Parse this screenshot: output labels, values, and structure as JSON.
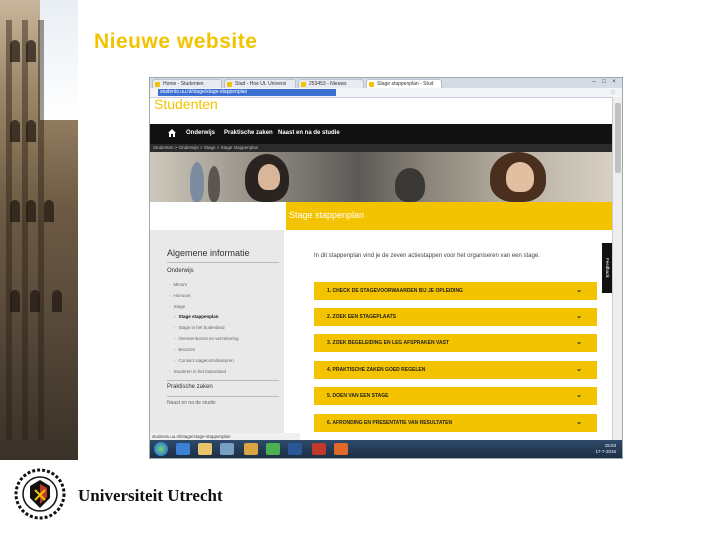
{
  "slide": {
    "title": "Nieuwe website",
    "logo_text": "Universiteit Utrecht",
    "accent_color": "#f3c300"
  },
  "browser": {
    "tabs": [
      {
        "label": "Home - Studenten",
        "active": false
      },
      {
        "label": "Stad - Hoe Ut. Universi",
        "active": false
      },
      {
        "label": "253453 - Nieuws",
        "active": false
      },
      {
        "label": "Stage stappenplan - Stud",
        "active": true
      }
    ],
    "url": "students.uu.nl/stage/stage-stappenplan",
    "window_controls": [
      "–",
      "□",
      "×"
    ]
  },
  "site": {
    "title": "Studenten",
    "nav": [
      "Onderwijs",
      "Praktische zaken",
      "Naast en na de studie"
    ],
    "breadcrumb": "Studenten > Onderwijs > Stage > Stage stappenplan",
    "hero_band_title": "Stage stappenplan",
    "sidebar": {
      "heading": "Algemene informatie",
      "section1": "Onderwijs",
      "items": [
        {
          "label": "Minors",
          "current": false
        },
        {
          "label": "Honours",
          "current": false
        },
        {
          "label": "Stage",
          "current": false
        },
        {
          "label": "Stage stappenplan",
          "current": true
        },
        {
          "label": "Stage in het buitenland",
          "current": false
        },
        {
          "label": "Overeenkomst en verzekering",
          "current": false
        },
        {
          "label": "Beurzen",
          "current": false
        },
        {
          "label": "Contact stagecoördinatoren",
          "current": false
        },
        {
          "label": "Studeren in het buitenland",
          "current": false
        }
      ],
      "section2": "Praktische zaken",
      "section3": "Naast en na de studie"
    },
    "intro": "In dit stappenplan vind je de zeven actiestappen voor het organiseren van een stage.",
    "steps": [
      "1. CHECK DE STAGEVOORWAARDEN BIJ JE OPLEIDING",
      "2. ZOEK EEN STAGEPLAATS",
      "3. ZOEK BEGELEIDING EN LEG AFSPRAKEN VAST",
      "4. PRAKTISCHE ZAKEN GOED REGELEN",
      "5. DOEN VAN EEN STAGE",
      "6. AFRONDING EN PRESENTATIE VAN RESULTATEN"
    ],
    "feedback": "Feedback",
    "status": "students.uu.nl/stage/stage-stappenplan"
  },
  "taskbar": {
    "time": "15:03",
    "date": "17-7-2015"
  }
}
